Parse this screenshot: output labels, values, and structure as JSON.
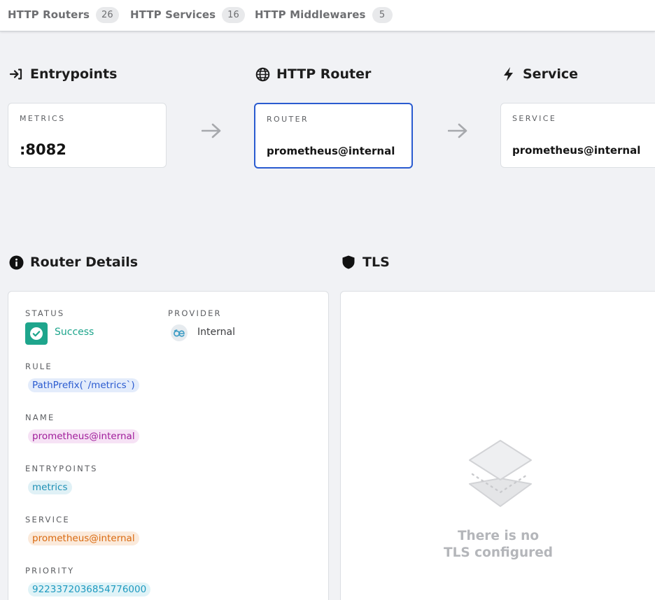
{
  "tabs": [
    {
      "label": "HTTP Routers",
      "count": "26"
    },
    {
      "label": "HTTP Services",
      "count": "16"
    },
    {
      "label": "HTTP Middlewares",
      "count": "5"
    }
  ],
  "flow": {
    "entrypoints": {
      "title": "Entrypoints",
      "label": "METRICS",
      "value": ":8082"
    },
    "router": {
      "title": "HTTP Router",
      "label": "ROUTER",
      "value": "prometheus@internal"
    },
    "service": {
      "title": "Service",
      "label": "SERVICE",
      "value": "prometheus@internal"
    }
  },
  "details": {
    "title": "Router Details",
    "status_label": "STATUS",
    "status_value": "Success",
    "provider_label": "PROVIDER",
    "provider_value": "Internal",
    "rule_label": "RULE",
    "rule_value": "PathPrefix(`/metrics`)",
    "name_label": "NAME",
    "name_value": "prometheus@internal",
    "entrypoints_label": "ENTRYPOINTS",
    "entrypoints_value": "metrics",
    "service_label": "SERVICE",
    "service_value": "prometheus@internal",
    "priority_label": "PRIORITY",
    "priority_value": "9223372036854776000"
  },
  "tls": {
    "title": "TLS",
    "empty_line1": "There is no",
    "empty_line2": "TLS configured"
  },
  "colors": {
    "accent_blue": "#2a5bd0",
    "success_green": "#1ea58c",
    "rule_chip_bg": "#e3ecfb",
    "rule_chip_fg": "#2a5bd0",
    "name_chip_bg": "#f6e2f5",
    "name_chip_fg": "#a01c9a",
    "entry_chip_bg": "#e0f1f6",
    "entry_chip_fg": "#1e8fb5",
    "service_chip_bg": "#fbeadb",
    "service_chip_fg": "#d9690e",
    "priority_chip_bg": "#e0f3f7",
    "priority_chip_fg": "#1e9ac0"
  },
  "icons": {
    "entrypoints": "sign-in-icon",
    "router": "globe-icon",
    "service": "bolt-icon",
    "details": "info-circle-icon",
    "tls": "shield-icon",
    "status": "check-circle-icon",
    "provider": "traefik-internal-logo",
    "empty": "layers-icon",
    "flow_arrow": "arrow-right-icon"
  }
}
